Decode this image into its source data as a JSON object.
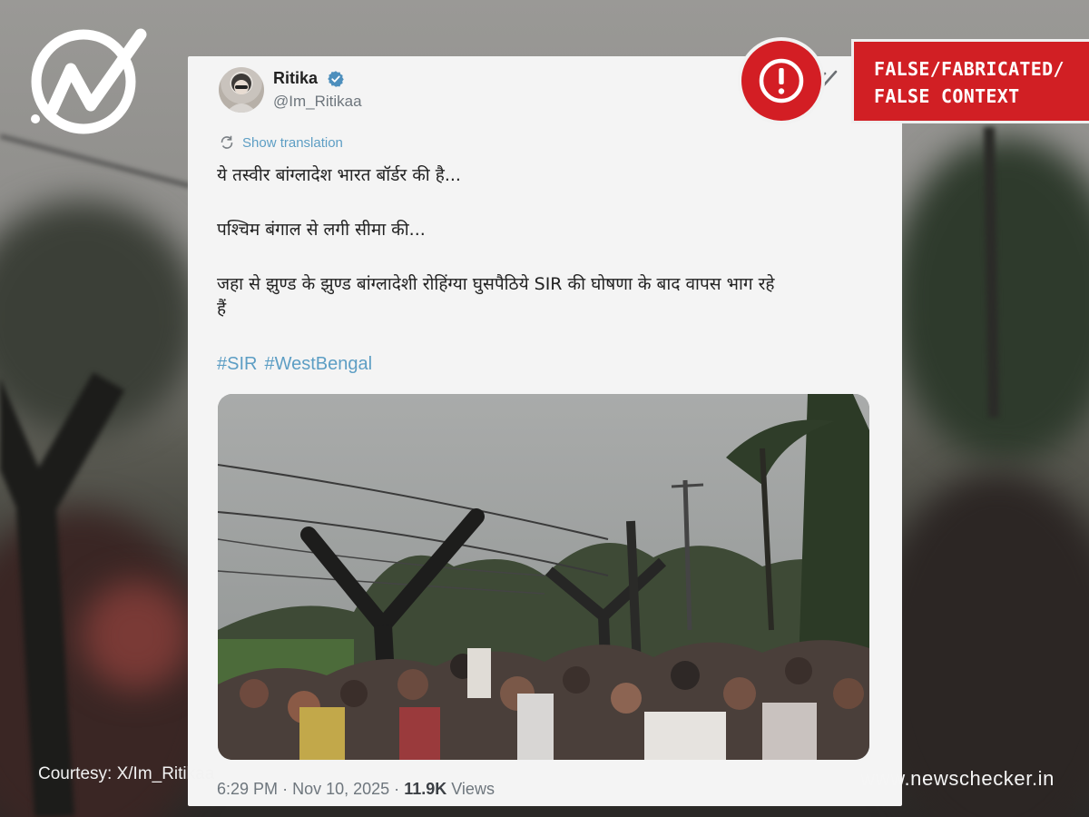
{
  "tweet": {
    "author_name": "Ritika",
    "author_handle": "@Im_Ritikaa",
    "translate_label": "Show translation",
    "lines": [
      "ये तस्वीर बांग्लादेश भारत बॉर्डर की है...",
      "पश्चिम बंगाल से लगी सीमा की...",
      "जहा से झुण्ड के झुण्ड बांग्लादेशी रोहिंग्या घुसपैठिये SIR की घोषणा के बाद वापस भाग रहे",
      "हैं"
    ],
    "hashtags": [
      "#SIR",
      "#WestBengal"
    ],
    "time": "6:29 PM",
    "date": "Nov 10, 2025",
    "separator": "·",
    "views_count": "11.9K",
    "views_label": "Views"
  },
  "verdict": {
    "line1": "FALSE/FABRICATED/",
    "line2": "FALSE CONTEXT",
    "color": "#d11f24"
  },
  "footer": {
    "courtesy": "Courtesy: X/Im_Ritikaa",
    "site": "www.newschecker.in"
  },
  "icons": {
    "brand": "newschecker-logo",
    "alert": "exclamation-circle-icon",
    "verified": "verified-badge-icon",
    "translate": "translate-icon",
    "grok": "grok-icon"
  }
}
